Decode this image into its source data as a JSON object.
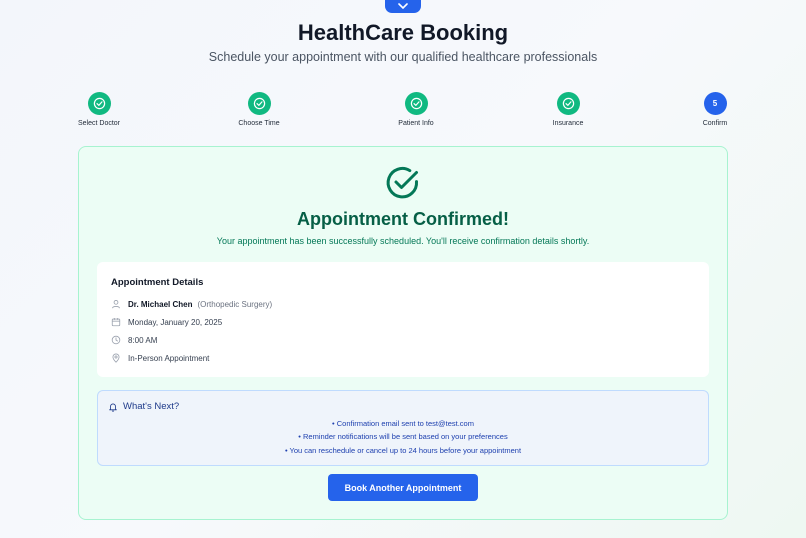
{
  "app": {
    "title": "HealthCare Booking",
    "subtitle": "Schedule your appointment with our qualified healthcare professionals"
  },
  "steps": [
    {
      "label": "Select Doctor",
      "status": "complete",
      "icon": "check-circle-icon"
    },
    {
      "label": "Choose Time",
      "status": "complete",
      "icon": "check-circle-icon"
    },
    {
      "label": "Patient Info",
      "status": "complete",
      "icon": "check-circle-icon"
    },
    {
      "label": "Insurance",
      "status": "complete",
      "icon": "check-circle-icon"
    },
    {
      "label": "Confirm",
      "status": "current",
      "number": "5"
    }
  ],
  "confirmation": {
    "title": "Appointment Confirmed!",
    "message": "Your appointment has been successfully scheduled. You'll receive confirmation details shortly."
  },
  "details": {
    "title": "Appointment Details",
    "doctor": "Dr. Michael Chen",
    "specialty": "(Orthopedic Surgery)",
    "date": "Monday, January 20, 2025",
    "time": "8:00 AM",
    "type": "In-Person Appointment"
  },
  "next": {
    "title": "What's Next?",
    "items": [
      "• Confirmation email sent to test@test.com",
      "• Reminder notifications will be sent based on your preferences",
      "• You can reschedule or cancel up to 24 hours before your appointment"
    ]
  },
  "actions": {
    "book_another": "Book Another Appointment"
  },
  "colors": {
    "primary": "#2563eb",
    "success": "#10b981",
    "success_dark": "#065f46",
    "panel_bg": "#ecfdf5"
  }
}
